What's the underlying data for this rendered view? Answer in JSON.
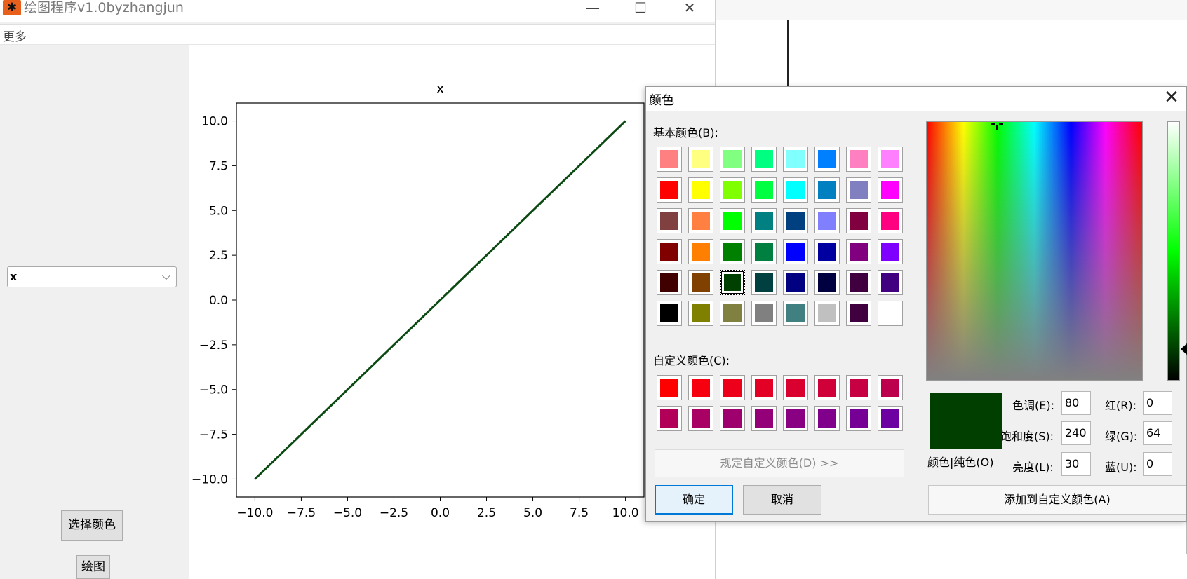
{
  "main_window": {
    "title": "绘图程序v1.0byzhangjun",
    "icon": "app-icon",
    "controls": {
      "minimize": "—",
      "maximize": "☐",
      "close": "✕"
    },
    "menu": [
      "更多"
    ],
    "formula_select": {
      "value": "x",
      "arrow": "⌵"
    },
    "choose_color_button": "选择颜色",
    "draw_button": "绘图"
  },
  "chart_data": {
    "type": "line",
    "title": "x",
    "xlabel": "",
    "ylabel": "",
    "xlim": [
      -11,
      11
    ],
    "ylim": [
      -11,
      11
    ],
    "xticks": [
      -10.0,
      -7.5,
      -5.0,
      -2.5,
      0.0,
      2.5,
      5.0,
      7.5,
      10.0
    ],
    "yticks": [
      -10.0,
      -7.5,
      -5.0,
      -2.5,
      0.0,
      2.5,
      5.0,
      7.5,
      10.0
    ],
    "xtick_labels": [
      "−10.0",
      "−7.5",
      "−5.0",
      "−2.5",
      "0.0",
      "2.5",
      "5.0",
      "7.5",
      "10.0"
    ],
    "ytick_labels": [
      "−10.0",
      "−7.5",
      "−5.0",
      "−2.5",
      "0.0",
      "2.5",
      "5.0",
      "7.5",
      "10.0"
    ],
    "grid": false,
    "series": [
      {
        "x": [
          -10,
          10
        ],
        "y": [
          -10,
          10
        ],
        "color": "#0b4a12"
      }
    ]
  },
  "color_dialog": {
    "title": "颜色",
    "close": "✕",
    "basic_colors_label": "基本颜色(B):",
    "basic_colors": [
      "#ff8080",
      "#ffff80",
      "#80ff80",
      "#00ff80",
      "#80ffff",
      "#0080ff",
      "#ff80c0",
      "#ff80ff",
      "#ff0000",
      "#ffff00",
      "#80ff00",
      "#00ff40",
      "#00ffff",
      "#0080c0",
      "#8080c0",
      "#ff00ff",
      "#804040",
      "#ff8040",
      "#00ff00",
      "#008080",
      "#004080",
      "#8080ff",
      "#800040",
      "#ff0080",
      "#800000",
      "#ff8000",
      "#008000",
      "#008040",
      "#0000ff",
      "#0000a0",
      "#800080",
      "#8000ff",
      "#400000",
      "#804000",
      "#004000",
      "#004040",
      "#000080",
      "#000040",
      "#400040",
      "#400080",
      "#000000",
      "#808000",
      "#808040",
      "#808080",
      "#408080",
      "#c0c0c0",
      "#400040",
      "#ffffff"
    ],
    "selected_basic_index": 34,
    "custom_colors_label": "自定义颜色(C):",
    "custom_colors": [
      "#ff0000",
      "#f6000f",
      "#ec001a",
      "#e20025",
      "#d9002f",
      "#d00039",
      "#c60043",
      "#bc004e",
      "#b20058",
      "#a80063",
      "#9e006d",
      "#940078",
      "#8a0082",
      "#80008c",
      "#760096",
      "#6c00a0"
    ],
    "define_custom_button": "规定自定义颜色(D) >>",
    "ok_button": "确定",
    "cancel_button": "取消",
    "color_solid_label": "颜色|纯色(O)",
    "preview_color": "#003f00",
    "fields": {
      "hue_label": "色调(E):",
      "hue": "80",
      "sat_label": "饱和度(S):",
      "sat": "240",
      "lum_label": "亮度(L):",
      "lum": "30",
      "red_label": "红(R):",
      "red": "0",
      "green_label": "绿(G):",
      "green": "64",
      "blue_label": "蓝(U):",
      "blue": "0"
    },
    "add_custom_button": "添加到自定义颜色(A)"
  }
}
